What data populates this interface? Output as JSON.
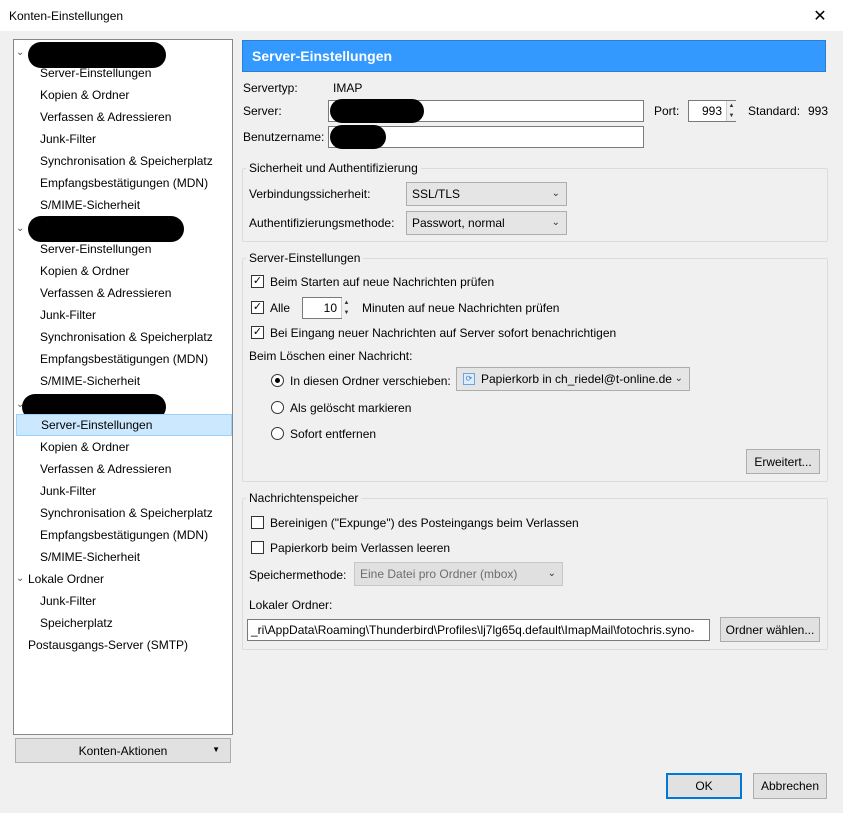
{
  "window": {
    "title": "Konten-Einstellungen",
    "close_glyph": "✕"
  },
  "tree": {
    "account_items": [
      "Server-Einstellungen",
      "Kopien & Ordner",
      "Verfassen & Adressieren",
      "Junk-Filter",
      "Synchronisation & Speicherplatz",
      "Empfangsbestätigungen (MDN)",
      "S/MIME-Sicherheit"
    ],
    "local_root": "Lokale Ordner",
    "local_items": [
      "Junk-Filter",
      "Speicherplatz"
    ],
    "smtp": "Postausgangs-Server (SMTP)"
  },
  "konten_aktionen": "Konten-Aktionen",
  "header": "Server-Einstellungen",
  "server": {
    "servertyp_label": "Servertyp:",
    "servertyp_value": "IMAP",
    "server_label": "Server:",
    "port_label": "Port:",
    "port_value": "993",
    "standard_label": "Standard:",
    "standard_value": "993",
    "username_label": "Benutzername:"
  },
  "security": {
    "title": "Sicherheit und Authentifizierung",
    "conn_label": "Verbindungssicherheit:",
    "conn_value": "SSL/TLS",
    "auth_label": "Authentifizierungsmethode:",
    "auth_value": "Passwort, normal"
  },
  "server_settings": {
    "title": "Server-Einstellungen",
    "check_startup": "Beim Starten auf neue Nachrichten prüfen",
    "check_every_pre": "Alle",
    "check_every_value": "10",
    "check_every_post": "Minuten auf neue Nachrichten prüfen",
    "notify": "Bei Eingang neuer Nachrichten auf Server sofort benachrichtigen",
    "delete_label": "Beim Löschen einer Nachricht:",
    "move_label": "In diesen Ordner verschieben:",
    "move_folder": "Papierkorb in ch_riedel@t-online.de",
    "mark_deleted": "Als gelöscht markieren",
    "remove_now": "Sofort entfernen",
    "advanced_button": "Erweitert..."
  },
  "storage": {
    "title": "Nachrichtenspeicher",
    "expunge": "Bereinigen (\"Expunge\") des Posteingangs beim Verlassen",
    "empty_trash": "Papierkorb beim Verlassen leeren",
    "method_label": "Speichermethode:",
    "method_value": "Eine Datei pro Ordner (mbox)",
    "local_folder_label": "Lokaler Ordner:",
    "local_folder_value": "_ri\\AppData\\Roaming\\Thunderbird\\Profiles\\lj7lg65q.default\\ImapMail\\fotochris.syno-",
    "choose_folder_button": "Ordner wählen..."
  },
  "footer": {
    "ok": "OK",
    "cancel": "Abbrechen"
  }
}
